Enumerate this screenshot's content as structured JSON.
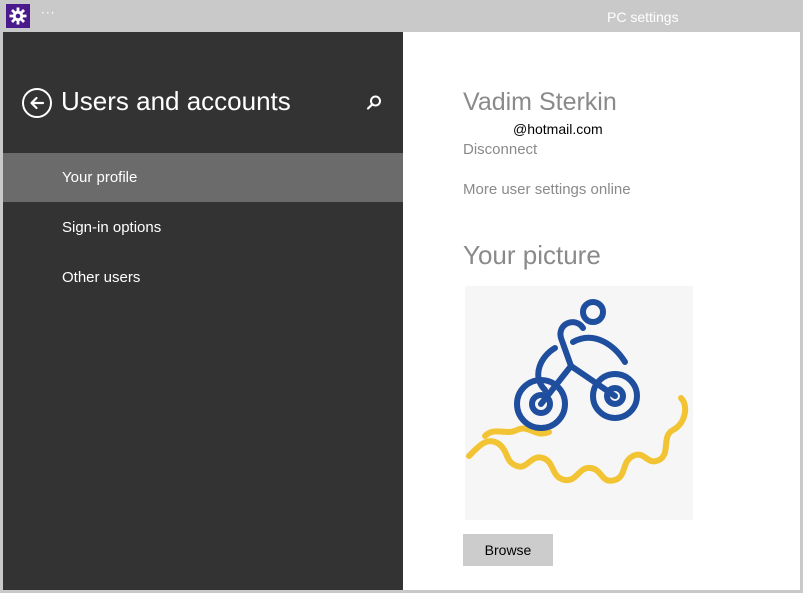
{
  "window": {
    "title": "PC settings",
    "menu_dots": "···",
    "app_icon": "gear-icon",
    "colors": {
      "titlebar": "#c9c9c9",
      "sidebar": "#333333",
      "selected": "#6b6b6b",
      "accent": "#4a1a8c"
    }
  },
  "sidebar": {
    "title": "Users and accounts",
    "back_icon": "back-arrow-icon",
    "search_icon": "search-icon",
    "items": [
      {
        "label": "Your profile",
        "selected": true
      },
      {
        "label": "Sign-in options",
        "selected": false
      },
      {
        "label": "Other users",
        "selected": false
      }
    ]
  },
  "profile": {
    "name": "Vadim Sterkin",
    "email": "@hotmail.com",
    "disconnect_label": "Disconnect",
    "more_settings_label": "More user settings online"
  },
  "picture_section": {
    "title": "Your picture",
    "picture_icon": "cyclist-icon",
    "browse_label": "Browse"
  }
}
